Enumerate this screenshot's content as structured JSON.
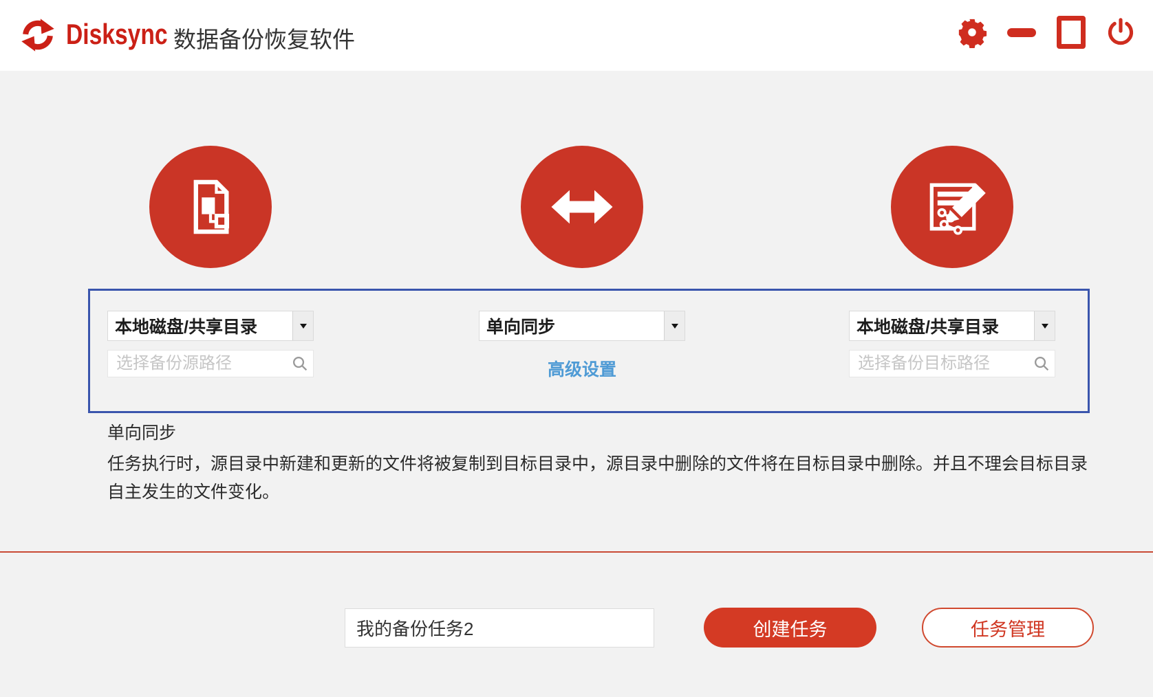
{
  "window": {
    "brand": "Disksync",
    "app_title": "数据备份恢复软件"
  },
  "wizard": {
    "source": {
      "type_selected": "本地磁盘/共享目录",
      "path_placeholder": "选择备份源路径"
    },
    "sync_mode": {
      "type_selected": "单向同步",
      "advanced_link": "高级设置"
    },
    "target": {
      "type_selected": "本地磁盘/共享目录",
      "path_placeholder": "选择备份目标路径"
    }
  },
  "mode_info": {
    "title": "单向同步",
    "description": "任务执行时，源目录中新建和更新的文件将被复制到目标目录中，源目录中删除的文件将在目标目录中删除。并且不理会目标目录自主发生的文件变化。"
  },
  "footer": {
    "task_name_value": "我的备份任务2",
    "create_task_label": "创建任务",
    "task_manage_label": "任务管理"
  },
  "icons": {
    "logo": "sync-arrows",
    "settings": "gear",
    "minimize": "minus-bar",
    "maximize": "square-outline",
    "close": "power",
    "source_circle": "document-flowchart",
    "mode_circle": "double-headed-arrow",
    "target_circle": "report-edit-pencil",
    "path_search": "magnifier",
    "dropdown": "caret-down"
  },
  "colors": {
    "brand_red": "#cb2016",
    "circle_red": "#ca3526",
    "accent_red": "#d43a24",
    "frame_blue": "#3a55ad",
    "link_blue": "#4f9bd5",
    "background_gray": "#f2f2f2"
  }
}
